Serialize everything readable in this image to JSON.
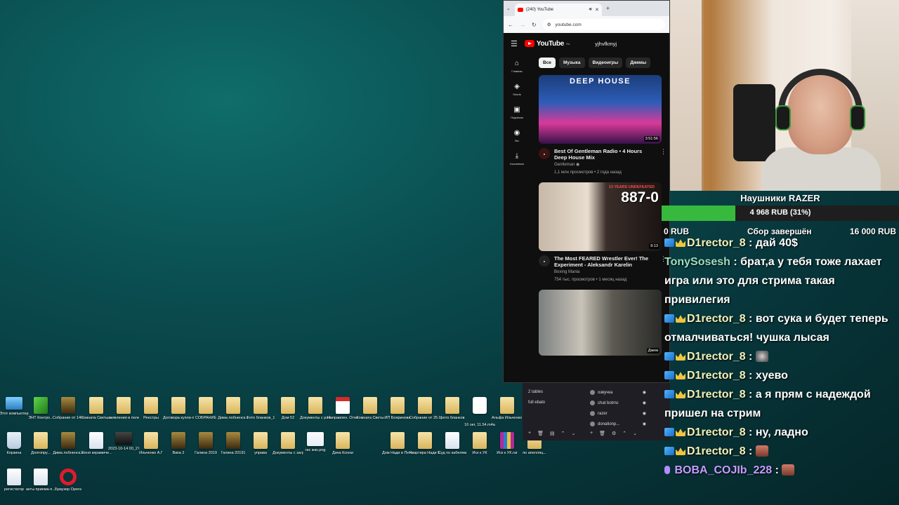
{
  "desktop": {
    "row1": [
      {
        "label": "Этот компьютер",
        "icon": "computer-icon",
        "style": "pc"
      },
      {
        "label": "ЭНТ Контро...",
        "icon": "spreadsheet-icon",
        "style": "green"
      },
      {
        "label": "Собрание от 14.02",
        "icon": "folder-icon",
        "style": "dark"
      },
      {
        "label": "Комната Светы на...",
        "icon": "folder-icon",
        "style": ""
      },
      {
        "label": "заявления в полицию",
        "icon": "folder-icon",
        "style": ""
      },
      {
        "label": "Реестры",
        "icon": "folder-icon",
        "style": ""
      },
      {
        "label": "Договора купли-про...",
        "icon": "folder-icon",
        "style": ""
      },
      {
        "label": "СОБРАНИЕ",
        "icon": "folder-icon",
        "style": ""
      },
      {
        "label": "Дима лобненск...",
        "icon": "folder-icon",
        "style": ""
      },
      {
        "label": "Фото бланков_1",
        "icon": "folder-icon",
        "style": ""
      },
      {
        "label": "Дом 52",
        "icon": "folder-icon",
        "style": ""
      },
      {
        "label": "Документы с рабочег...",
        "icon": "folder-icon",
        "style": ""
      },
      {
        "label": "Направлен. Ответ Ил...",
        "icon": "pdf-icon",
        "style": "pdf"
      },
      {
        "label": "Комната Светы",
        "icon": "folder-icon",
        "style": ""
      },
      {
        "label": "ИП Бояринова",
        "icon": "folder-icon",
        "style": ""
      },
      {
        "label": "Собрание от 25.03.2024",
        "icon": "folder-icon",
        "style": ""
      },
      {
        "label": "фото бланков",
        "icon": "folder-icon",
        "style": ""
      },
      {
        "label": "16 окт, 11.54.m4a",
        "icon": "audio-icon",
        "style": "video"
      },
      {
        "label": "Альфа Ильченко В",
        "icon": "folder-icon",
        "style": ""
      }
    ],
    "row2": [
      {
        "label": "Корзина",
        "icon": "recycle-bin-icon",
        "style": "bin"
      },
      {
        "label": "Долгопру...",
        "icon": "folder-icon",
        "style": ""
      },
      {
        "label": "Дима лобненск...",
        "icon": "folder-icon",
        "style": "dark"
      },
      {
        "label": "Женя керамиче...",
        "icon": "folder-icon",
        "style": "doc"
      },
      {
        "label": "2023-10-14 00_27_16-...",
        "icon": "image-icon",
        "style": "thumb"
      },
      {
        "label": "Ильченко А.Г",
        "icon": "folder-icon",
        "style": ""
      },
      {
        "label": "Вика 2",
        "icon": "folder-icon",
        "style": "dark"
      },
      {
        "label": "Галина 2019",
        "icon": "folder-icon",
        "style": "dark"
      },
      {
        "label": "Галина 20191",
        "icon": "folder-icon",
        "style": "dark"
      },
      {
        "label": "управа",
        "icon": "folder-icon",
        "style": ""
      },
      {
        "label": "Документы с загрузок",
        "icon": "folder-icon",
        "style": ""
      },
      {
        "label": "гис жкх.png",
        "icon": "image-icon",
        "style": "light"
      },
      {
        "label": "Дача Ксюхи",
        "icon": "folder-icon",
        "style": ""
      },
      {
        "label": "Дом Нади в Петелино",
        "icon": "folder-icon",
        "style": ""
      },
      {
        "label": "Квартира Нади Бел...",
        "icon": "folder-icon",
        "style": ""
      },
      {
        "label": "Суд по кабелям",
        "icon": "folder-icon",
        "style": "doc"
      },
      {
        "label": "Иск к УК",
        "icon": "folder-icon",
        "style": ""
      },
      {
        "label": "Иск к УК.rar",
        "icon": "archive-icon",
        "style": "rar"
      },
      {
        "label": "по апелляц...",
        "icon": "folder-icon",
        "style": ""
      }
    ],
    "row3": [
      {
        "label": "регистатор",
        "icon": "folder-icon",
        "style": "doc"
      },
      {
        "label": "акты приема-п...",
        "icon": "folder-icon",
        "style": "doc"
      },
      {
        "label": "Браузер Opera",
        "icon": "opera-icon",
        "style": "opera"
      }
    ]
  },
  "browser": {
    "tab_title": "(240) YouTube",
    "url": "youtube.com",
    "yt_logo": "YouTube",
    "yt_region": "RU",
    "search_query": "yjhvfkmyj",
    "sidebar": [
      {
        "label": "Главная",
        "glyph": "⌂",
        "icon": "home-icon"
      },
      {
        "label": "Shorts",
        "glyph": "◈",
        "icon": "shorts-icon"
      },
      {
        "label": "Подписки",
        "glyph": "▣",
        "icon": "subscriptions-icon"
      },
      {
        "label": "Вы",
        "glyph": "◉",
        "icon": "you-icon"
      },
      {
        "label": "Скачанные",
        "glyph": "⤓",
        "icon": "downloads-icon"
      }
    ],
    "chips": [
      "Все",
      "Музыка",
      "Видеоигры",
      "Джемы"
    ],
    "videos": [
      {
        "thumb_text": "DEEP HOUSE",
        "duration": "3:51:56",
        "title": "Best Of Gentleman Radio • 4 Hours Deep House Mix",
        "channel": "Gentleman",
        "meta": "1,1 млн просмотров • 2 года назад"
      },
      {
        "thumb_text": "887-0",
        "thumb_small": "13 YEARS UNDEFEATED",
        "duration": "8:13",
        "title": "The Most FEARED Wrestler Ever! The Experiment - Aleksandr Karelin",
        "channel": "Boxing Mania",
        "meta": "754 тыс. просмотров • 1 месяц назад"
      },
      {
        "duration": "Джем"
      }
    ]
  },
  "obs": {
    "scenes": [
      "2 tables",
      "full ebalo"
    ],
    "sources": [
      "озвучка",
      "chat botrnc",
      "razer",
      "donationp..."
    ]
  },
  "goal": {
    "title": "Наушники RAZER",
    "current": "4 968 RUB (31%)",
    "percent": 31,
    "min": "0 RUB",
    "status": "Сбор завершён",
    "max": "16 000 RUB"
  },
  "chat": [
    {
      "user": "D1rector_8",
      "text": "дай 40$",
      "badges": 2,
      "style": ""
    },
    {
      "user": "TonySosesh",
      "text": "брат,а у тебя тоже лахает игра или это для стрима такая привилегия",
      "badges": 0,
      "style": "alt"
    },
    {
      "user": "D1rector_8",
      "text": "вот сука и будет теперь отмалчиваться! чушка лысая",
      "badges": 2,
      "style": ""
    },
    {
      "user": "D1rector_8",
      "text": "",
      "badges": 2,
      "style": "",
      "emote": "e1"
    },
    {
      "user": "D1rector_8",
      "text": "хуево",
      "badges": 2,
      "style": ""
    },
    {
      "user": "D1rector_8",
      "text": "а я прям с надеждой пришел на стрим",
      "badges": 2,
      "style": ""
    },
    {
      "user": "D1rector_8",
      "text": "ну, ладно",
      "badges": 2,
      "style": ""
    },
    {
      "user": "D1rector_8",
      "text": "",
      "badges": 2,
      "style": "",
      "emote": "e2"
    },
    {
      "user": "BOBA_COJIb_228",
      "text": "",
      "badges": 1,
      "style": "boba",
      "emote": "e2",
      "mic": true
    }
  ]
}
